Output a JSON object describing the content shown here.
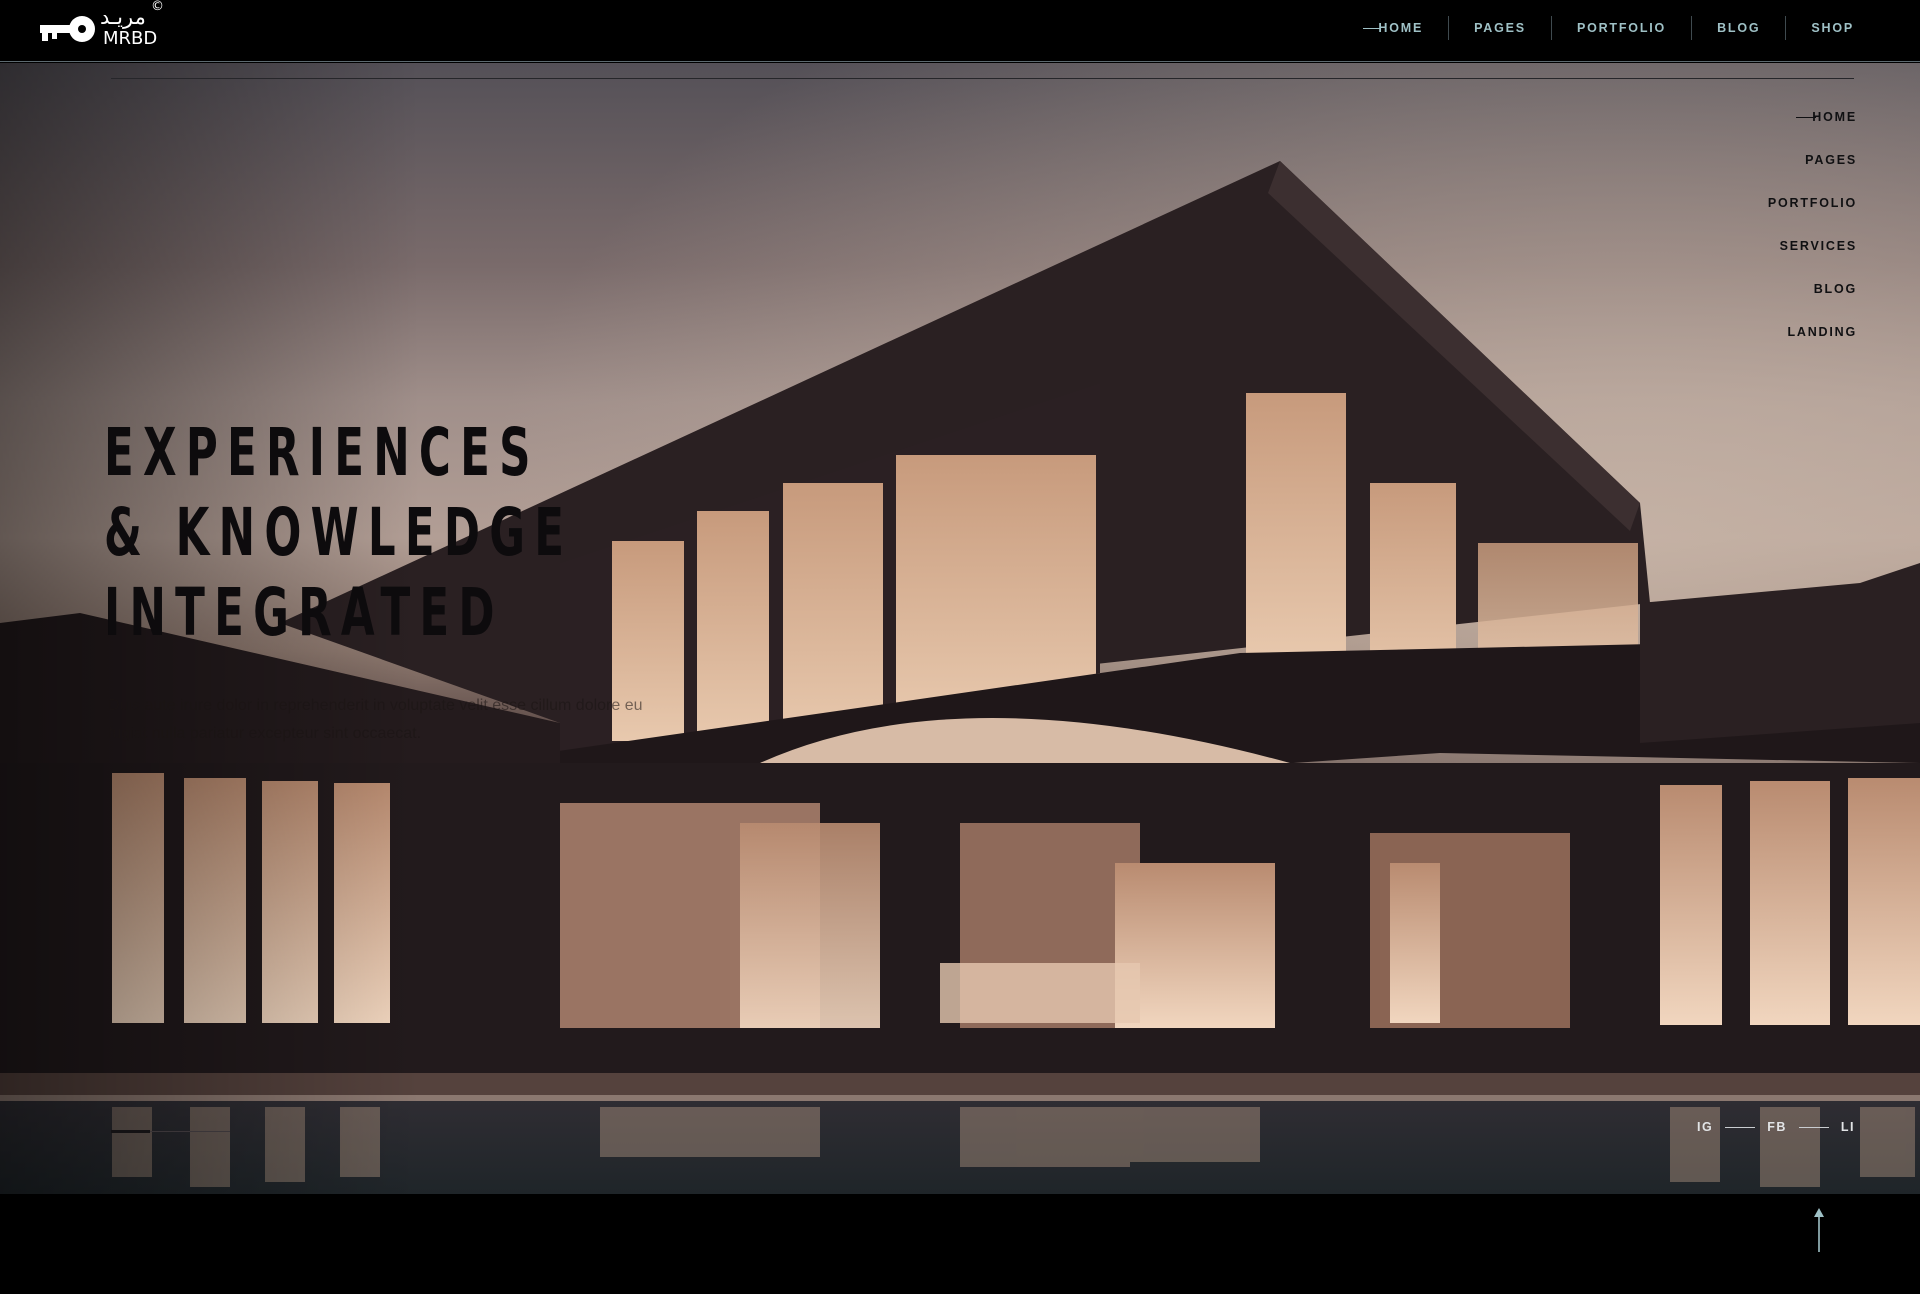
{
  "brand": {
    "arabic_name": "مريـد",
    "latin_name": "MRBD",
    "copyright_mark": "©"
  },
  "top_nav": {
    "items": [
      {
        "label": "HOME",
        "active": true
      },
      {
        "label": "PAGES",
        "active": false
      },
      {
        "label": "PORTFOLIO",
        "active": false
      },
      {
        "label": "BLOG",
        "active": false
      },
      {
        "label": "SHOP",
        "active": false
      }
    ]
  },
  "side_nav": {
    "items": [
      {
        "label": "HOME",
        "active": true
      },
      {
        "label": "PAGES",
        "active": false
      },
      {
        "label": "PORTFOLIO",
        "active": false
      },
      {
        "label": "SERVICES",
        "active": false
      },
      {
        "label": "BLOG",
        "active": false
      },
      {
        "label": "LANDING",
        "active": false
      }
    ]
  },
  "hero": {
    "headline_lines": [
      "EXPERIENCES",
      "& KNOWLEDGE",
      "INTEGRATED"
    ],
    "subtext": "Duis aute irure dolor in reprehenderit in voluptate velit esse cillum dolore eu fugiat nulla pariatur excepteur sint occaecat.",
    "slide_progress": 0.33,
    "background_image": "modern-house-at-dusk-with-pool"
  },
  "social": {
    "links": [
      "IG",
      "FB",
      "LI"
    ]
  },
  "scroll_top": {
    "icon": "arrow-up-icon"
  },
  "colors": {
    "nav_text": "#9fc1c6",
    "background": "#000000",
    "headline": "#0d0b0d"
  }
}
